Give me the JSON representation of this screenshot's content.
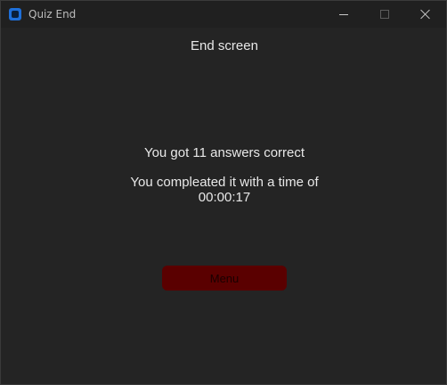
{
  "window": {
    "title": "Quiz End",
    "controls": {
      "minimize_icon": "minimize-icon",
      "maximize_icon": "maximize-icon",
      "close_icon": "close-icon"
    }
  },
  "content": {
    "heading": "End screen",
    "score_text": "You got 11 answers correct",
    "time_label": "You compleated it with a time of",
    "time_value": "00:00:17",
    "menu_button_label": "Menu"
  },
  "colors": {
    "background": "#242424",
    "titlebar": "#202020",
    "text": "#e8e8e8",
    "button": "#5a0000",
    "app_icon": "#1e6fd9"
  }
}
